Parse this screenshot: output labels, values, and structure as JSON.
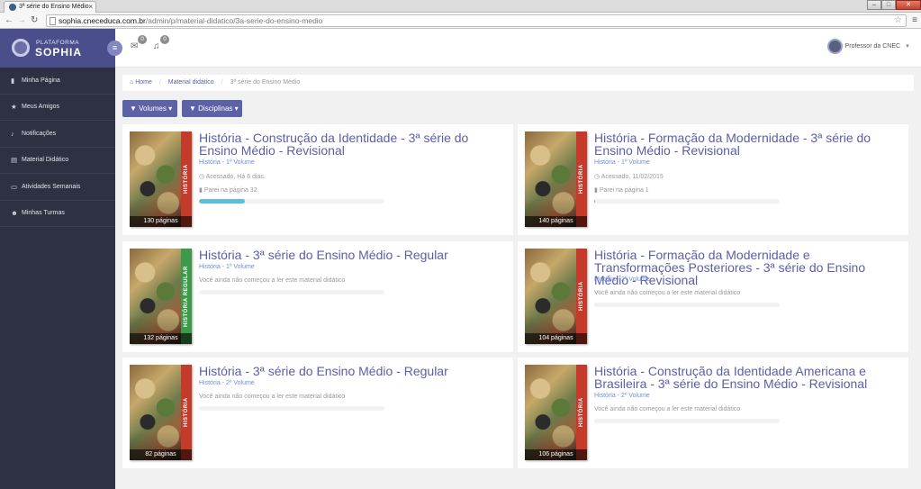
{
  "browser": {
    "tab_title": "3ª série do Ensino Médio",
    "url_host": "sophia.cneceduca.com.br",
    "url_path": "/admin/p/material-didatico/3a-serie-do-ensino-medio"
  },
  "brand": {
    "line1": "PLATAFORMA",
    "line2": "SOPHIA"
  },
  "sidebar": {
    "items": [
      {
        "label": "Minha Página",
        "icon": "bookmark-icon"
      },
      {
        "label": "Meus Amigos",
        "icon": "star-icon"
      },
      {
        "label": "Notificações",
        "icon": "bell-icon"
      },
      {
        "label": "Material Didático",
        "icon": "book-icon"
      },
      {
        "label": "Atividades Semanais",
        "icon": "file-icon"
      },
      {
        "label": "Minhas Turmas",
        "icon": "users-icon"
      }
    ]
  },
  "topbar": {
    "messages_count": "0",
    "notifications_count": "0",
    "user_name": "Professor da CNEC"
  },
  "breadcrumb": {
    "home": "Home",
    "level1": "Material didático",
    "current": "3ª série do Ensino Médio"
  },
  "filters": {
    "volumes": "Volumes",
    "disciplinas": "Disciplinas"
  },
  "books": [
    {
      "title": "História - Construção da Identidade - 3ª série do Ensino Médio - Revisional",
      "volume": "História - 1º Volume",
      "accessed": "Acessado, Há 6 dias.",
      "stopped": "Parei na página 32",
      "pages": "130 páginas",
      "progress": 0.246,
      "spine": "HISTÓRIA"
    },
    {
      "title": "História - Formação da Modernidade - 3ª série do Ensino Médio - Revisional",
      "volume": "História - 1º Volume",
      "accessed": "Acessado, 11/02/2015",
      "stopped": "Parei na página 1",
      "pages": "140 páginas",
      "progress": 0.007,
      "spine": "HISTÓRIA"
    },
    {
      "title": "História - 3ª série do Ensino Médio - Regular",
      "volume": "História - 1º Volume",
      "not_started": "Você ainda não começou a ler este material didático",
      "pages": "132 páginas",
      "progress": 0,
      "spine": "HISTÓRIA REGULAR"
    },
    {
      "title": "História - Formação da Modernidade e Transformações Posteriores - 3ª série do Ensino Médio - Revisional",
      "volume": "História - 2º Volume",
      "not_started": "Você ainda não começou a ler este material didático",
      "pages": "104 páginas",
      "progress": 0,
      "spine": "HISTÓRIA"
    },
    {
      "title": "História - 3ª série do Ensino Médio - Regular",
      "volume": "História - 2º Volume",
      "not_started": "Você ainda não começou a ler este material didático",
      "pages": "82 páginas",
      "progress": 0,
      "spine": "HISTÓRIA"
    },
    {
      "title": "História - Construção da Identidade Americana e Brasileira - 3ª série do Ensino Médio - Revisional",
      "volume": "História - 2º Volume",
      "not_started": "Você ainda não começou a ler este material didático",
      "pages": "106 páginas",
      "progress": 0,
      "spine": "HISTÓRIA"
    }
  ],
  "colors": {
    "sidebar": "#2e3141",
    "brand": "#4a4f8c",
    "accent": "#5b62a8",
    "progress": "#5bc0de",
    "title": "#5b5fa6"
  }
}
